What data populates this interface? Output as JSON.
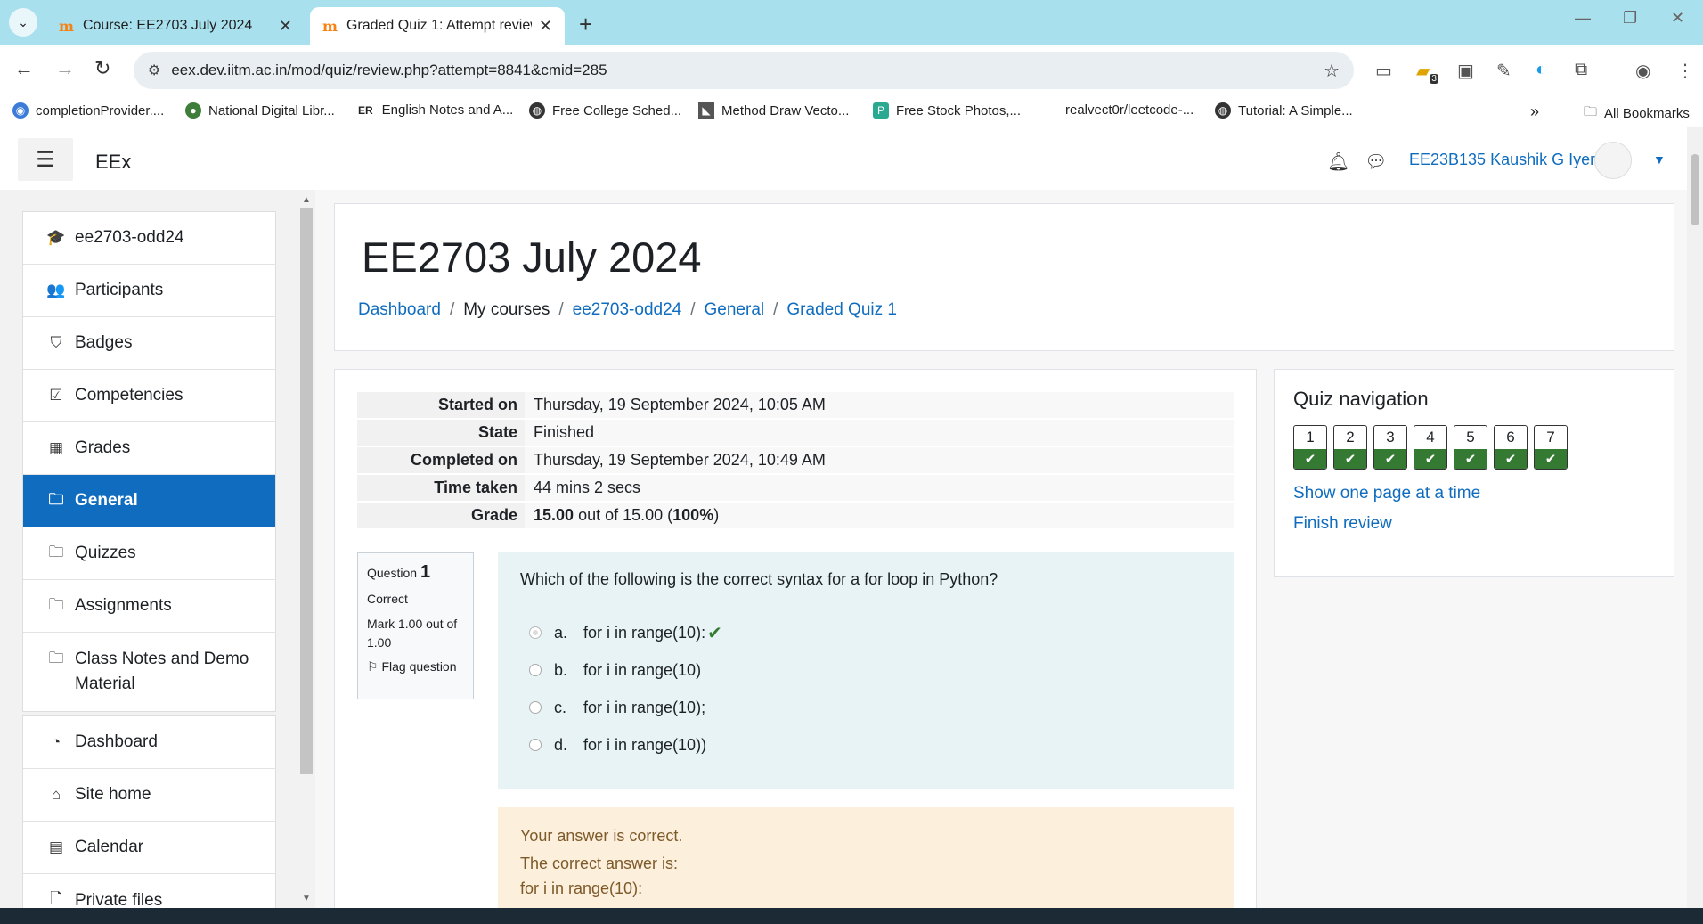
{
  "browser": {
    "tabs": [
      {
        "title": "Course: EE2703 July 2024",
        "favicon": "m"
      },
      {
        "title": "Graded Quiz 1: Attempt review",
        "favicon": "m"
      }
    ],
    "new_tab": "+",
    "url": "eex.dev.iitm.ac.in/mod/quiz/review.php?attempt=8841&cmid=285",
    "bookmarks": [
      "completionProvider....",
      "National Digital Libr...",
      "English Notes and A...",
      "Free College Sched...",
      "Method Draw Vecto...",
      "Free Stock Photos,...",
      "realvect0r/leetcode-...",
      "Tutorial: A Simple..."
    ],
    "bookmark_er_prefix": "ER",
    "more_bookmarks": "»",
    "all_bookmarks": "All Bookmarks",
    "extension_badge": "3"
  },
  "navbar": {
    "brand": "EEx",
    "user_name": "EE23B135 Kaushik G Iyer"
  },
  "sidebar": {
    "group1": [
      {
        "label": "ee2703-odd24",
        "icon": "graduation-cap-icon",
        "glyph": "🎓"
      },
      {
        "label": "Participants",
        "icon": "users-icon",
        "glyph": "👥"
      },
      {
        "label": "Badges",
        "icon": "shield-icon",
        "glyph": "⛉"
      },
      {
        "label": "Competencies",
        "icon": "check-square-icon",
        "glyph": "☑"
      },
      {
        "label": "Grades",
        "icon": "table-icon",
        "glyph": "▦"
      },
      {
        "label": "General",
        "icon": "folder-icon",
        "glyph": "🗀",
        "active": true
      },
      {
        "label": "Quizzes",
        "icon": "folder-icon",
        "glyph": "🗀"
      },
      {
        "label": "Assignments",
        "icon": "folder-icon",
        "glyph": "🗀"
      },
      {
        "label": "Class Notes and Demo Material",
        "icon": "folder-icon",
        "glyph": "🗀"
      }
    ],
    "group2": [
      {
        "label": "Dashboard",
        "icon": "dashboard-icon",
        "glyph": "◔"
      },
      {
        "label": "Site home",
        "icon": "home-icon",
        "glyph": "⌂"
      },
      {
        "label": "Calendar",
        "icon": "calendar-icon",
        "glyph": "▤"
      },
      {
        "label": "Private files",
        "icon": "file-icon",
        "glyph": "🗋"
      }
    ]
  },
  "header": {
    "course_title": "EE2703 July 2024",
    "breadcrumb": [
      "Dashboard",
      "My courses",
      "ee2703-odd24",
      "General",
      "Graded Quiz 1"
    ],
    "breadcrumb_sep": "/"
  },
  "summary": [
    {
      "label": "Started on",
      "value": "Thursday, 19 September 2024, 10:05 AM"
    },
    {
      "label": "State",
      "value": "Finished"
    },
    {
      "label": "Completed on",
      "value": "Thursday, 19 September 2024, 10:49 AM"
    },
    {
      "label": "Time taken",
      "value": "44 mins 2 secs"
    }
  ],
  "grade": {
    "label": "Grade",
    "score": "15.00",
    "out_of_text": "out of 15.00",
    "percent": "100%"
  },
  "question": {
    "prefix": "Question",
    "number": "1",
    "state": "Correct",
    "mark": "Mark 1.00 out of 1.00",
    "flag": "Flag question",
    "text": "Which of the following is the correct syntax for a for loop in Python?",
    "options": [
      {
        "letter": "a.",
        "text": "for i in range(10):",
        "selected": true,
        "correct": true
      },
      {
        "letter": "b.",
        "text": "for i in range(10)",
        "selected": false
      },
      {
        "letter": "c.",
        "text": "for i in range(10);",
        "selected": false
      },
      {
        "letter": "d.",
        "text": "for i in range(10))",
        "selected": false
      }
    ],
    "feedback_1": "Your answer is correct.",
    "feedback_2": "The correct answer is:",
    "feedback_3": "for i in range(10):"
  },
  "quiz_navigation": {
    "title": "Quiz navigation",
    "buttons": [
      "1",
      "2",
      "3",
      "4",
      "5",
      "6",
      "7"
    ],
    "show_one_page": "Show one page at a time",
    "finish_review": "Finish review"
  },
  "colors": {
    "link": "#0f6cbf",
    "correct_green": "#357a32",
    "formulation_bg": "#e7f3f5",
    "feedback_bg": "#fcefdc",
    "tabstrip": "#a9e0ee"
  }
}
